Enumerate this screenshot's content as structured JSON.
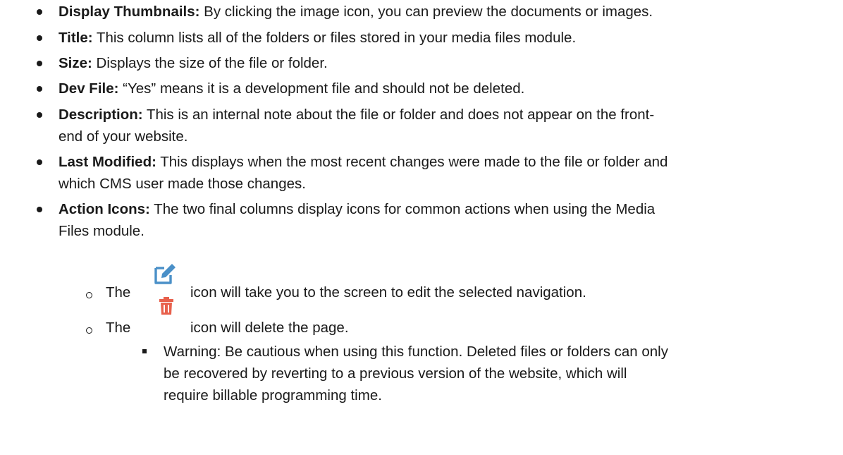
{
  "items": [
    {
      "term": "Display Thumbnails:",
      "text": " By clicking the image icon, you can preview the documents or images."
    },
    {
      "term": "Title:",
      "text": " This column lists all of the folders or files stored in your media files module."
    },
    {
      "term": "Size:",
      "text": " Displays the size of the file or folder."
    },
    {
      "term": "Dev File:",
      "text": " “Yes” means it is a development file and should not be deleted."
    },
    {
      "term": "Description:",
      "text": " This is an internal note about the file or folder and does not appear on the front-",
      "text2": "end of your website."
    },
    {
      "term": "Last Modified:",
      "text": " This displays when the most recent changes were made to the file or folder and",
      "text2": "which CMS user made those changes."
    },
    {
      "term": "Action Icons:",
      "text": " The two final columns display icons for common actions when using the Media",
      "text2": "Files module."
    }
  ],
  "sub_items": [
    {
      "prefix": "The",
      "icon": "edit-icon",
      "text": "icon will take you to the screen to edit the selected navigation."
    },
    {
      "prefix": "The",
      "icon": "trash-icon",
      "text": "icon will delete the page."
    }
  ],
  "warning": {
    "line1": "Warning: Be cautious when using this function. Deleted files or folders can only",
    "line2": "be recovered by reverting to a previous version of the website, which will",
    "line3": "require billable programming time."
  },
  "colors": {
    "edit_icon": "#4a90c8",
    "trash_icon": "#e8604c"
  }
}
